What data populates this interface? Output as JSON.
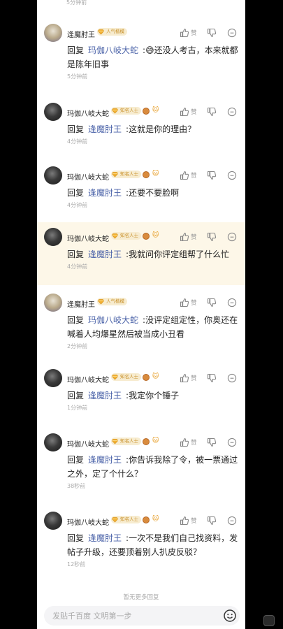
{
  "top_time": "5分钟前",
  "like_label": "赞",
  "reply_prefix": "回复",
  "comments": [
    {
      "user": "逢魔肘王",
      "badge": "人气楷模",
      "medals": false,
      "mention": "玛伽八岐大蛇",
      "emoji": "😅",
      "text": "还没人考古，本来就都是陈年旧事",
      "time": "5分钟前"
    },
    {
      "user": "玛伽八岐大蛇",
      "badge": "知名人士",
      "medals": true,
      "mention": "逢魔肘王",
      "text": "这就是你的理由？",
      "time": "4分钟前"
    },
    {
      "user": "玛伽八岐大蛇",
      "badge": "知名人士",
      "medals": true,
      "mention": "逢魔肘王",
      "text": "还要不要脸啊",
      "time": "4分钟前"
    },
    {
      "user": "玛伽八岐大蛇",
      "badge": "知名人士",
      "medals": true,
      "mention": "逢魔肘王",
      "text": "我就问你评定组帮了什么忙",
      "time": "4分钟前"
    },
    {
      "user": "逢魔肘王",
      "badge": "人气楷模",
      "medals": false,
      "mention": "玛伽八岐大蛇",
      "text": "没评定组定性，你奥还在喊着人均爆星然后被当成小丑看",
      "time": "2分钟前"
    },
    {
      "user": "玛伽八岐大蛇",
      "badge": "知名人士",
      "medals": true,
      "mention": "逢魔肘王",
      "text": "我定你个锤子",
      "time": "1分钟前"
    },
    {
      "user": "玛伽八岐大蛇",
      "badge": "知名人士",
      "medals": true,
      "mention": "逢魔肘王",
      "text": "你告诉我除了令，被一票通过之外，定了个什么？",
      "time": "38秒前"
    },
    {
      "user": "玛伽八岐大蛇",
      "badge": "知名人士",
      "medals": true,
      "mention": "逢魔肘王",
      "text": "一次不是我们自己找资料，发帖子升级，还要顶着别人扒皮反驳？",
      "time": "12秒前"
    }
  ],
  "no_more": "暂无更多回复",
  "input_placeholder": "发贴千百度 文明第一步",
  "colors": {
    "mention": "#4a62a8",
    "badge_bg": "#f7ecd0",
    "badge_text": "#c8902a",
    "highlight_bg": "#fdf7e8"
  }
}
